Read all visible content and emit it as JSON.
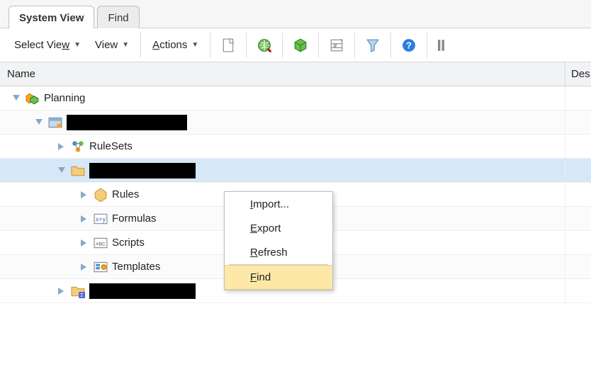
{
  "tabs": {
    "system_view": "System View",
    "find": "Find"
  },
  "toolbar": {
    "select_view": {
      "pre": "Select Vie",
      "u": "w"
    },
    "view": {
      "text": "View"
    },
    "actions": {
      "u": "A",
      "rest": "ctions"
    }
  },
  "columns": {
    "name": "Name",
    "description": "Des"
  },
  "tree": {
    "planning": "Planning",
    "redacted1": "",
    "rulesets": "RuleSets",
    "redacted2": "",
    "rules": "Rules",
    "formulas": "Formulas",
    "scripts": "Scripts",
    "templates": "Templates",
    "redacted3": ""
  },
  "context_menu": {
    "import": {
      "u": "I",
      "rest": "mport..."
    },
    "export": {
      "u": "E",
      "rest": "xport"
    },
    "refresh": {
      "u": "R",
      "rest": "efresh"
    },
    "find": {
      "u": "F",
      "rest": "ind"
    }
  }
}
